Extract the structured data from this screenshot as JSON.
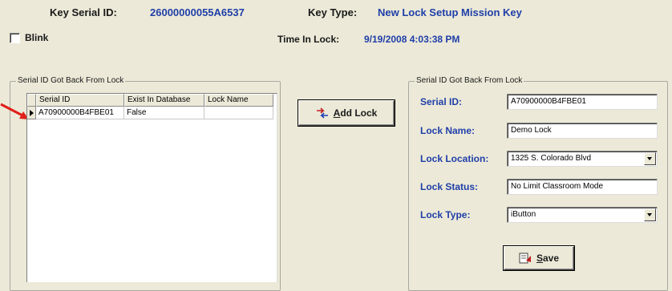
{
  "header": {
    "key_serial_label": "Key Serial ID:",
    "key_serial_value": "26000000055A6537",
    "key_type_label": "Key Type:",
    "key_type_value": "New Lock Setup Mission Key",
    "time_label": "Time In Lock:",
    "time_value": "9/19/2008 4:03:38 PM"
  },
  "blink": {
    "label": "Blink",
    "checked": false
  },
  "left_group": {
    "title": "Serial ID Got Back From Lock",
    "columns": [
      "Serial ID",
      "Exist In Database",
      "Lock Name"
    ],
    "rows": [
      {
        "serial_id": "A70900000B4FBE01",
        "exists": "False",
        "lock_name": ""
      }
    ]
  },
  "add_lock": {
    "label_ul": "A",
    "label_rest": "dd Lock"
  },
  "right_group": {
    "title": "Serial ID Got Back From Lock",
    "serial_id_label": "Serial ID:",
    "serial_id_value": "A70900000B4FBE01",
    "lock_name_label": "Lock Name:",
    "lock_name_value": "Demo Lock",
    "lock_location_label": "Lock Location:",
    "lock_location_value": "1325 S. Colorado Blvd",
    "lock_status_label": "Lock Status:",
    "lock_status_value": "No Limit Classroom Mode",
    "lock_type_label": "Lock Type:",
    "lock_type_value": "iButton",
    "save_ul": "S",
    "save_rest": "ave"
  },
  "colors": {
    "accent_blue": "#1f3fa8",
    "annotation_arrow": "#e0201a",
    "window_bg": "#ece9d8"
  }
}
